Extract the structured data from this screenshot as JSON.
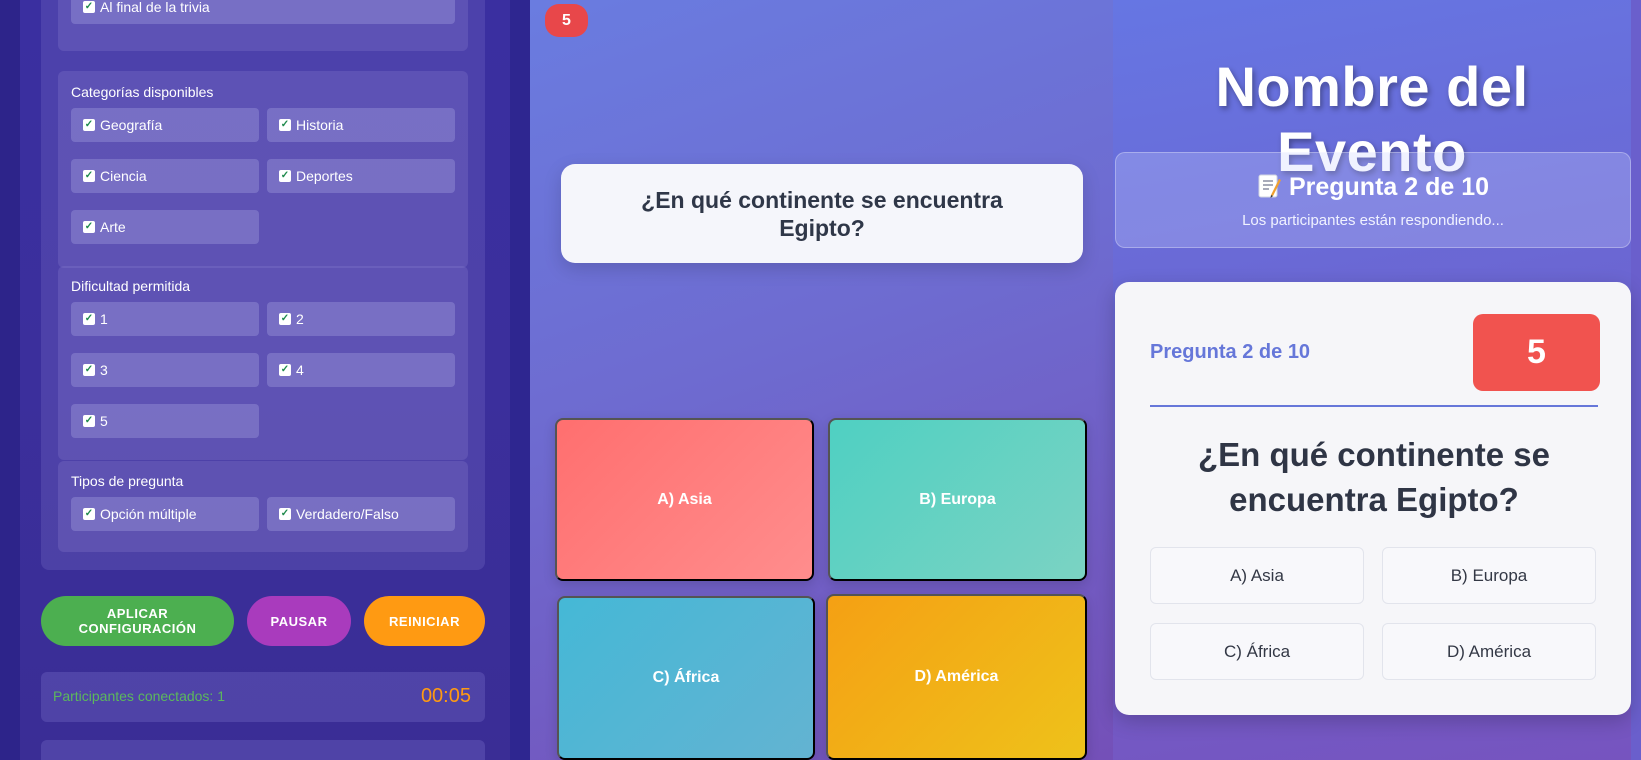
{
  "admin": {
    "end_option": "Al final de la trivia",
    "categories": {
      "title": "Categorías disponibles",
      "items": [
        "Geografía",
        "Historia",
        "Ciencia",
        "Deportes",
        "Arte"
      ]
    },
    "difficulty": {
      "title": "Dificultad permitida",
      "items": [
        "1",
        "2",
        "3",
        "4",
        "5"
      ]
    },
    "question_types": {
      "title": "Tipos de pregunta",
      "items": [
        "Opción múltiple",
        "Verdadero/Falso"
      ]
    },
    "buttons": {
      "apply": "APLICAR CONFIGURACIÓN",
      "pause": "PAUSAR",
      "reset": "REINICIAR"
    },
    "status": {
      "participants": "Participantes conectados: 1",
      "elapsed": "00:05"
    }
  },
  "player": {
    "timer": "5",
    "question": "¿En qué continente se encuentra Egipto?",
    "answers": [
      "A) Asia",
      "B) Europa",
      "C) África",
      "D) América"
    ]
  },
  "host": {
    "event_title": "Nombre del Evento",
    "status_title": "Pregunta 2 de 10",
    "status_icon": "memo-icon",
    "status_subtitle": "Los participantes están respondiendo...",
    "question_label": "Pregunta 2 de 10",
    "timer": "5",
    "question": "¿En qué continente se encuentra Egipto?",
    "options": [
      "A) Asia",
      "B) Europa",
      "C) África",
      "D) América"
    ]
  },
  "colors": {
    "answer_a": "#ff6f6f",
    "answer_b": "#4fd0c2",
    "answer_c": "#45b8d6",
    "answer_d": "#f5a014",
    "apply_button": "#4caf50",
    "pause_button": "#a93bbd",
    "reset_button": "#ff9a12",
    "timer_red": "#f1534f"
  }
}
